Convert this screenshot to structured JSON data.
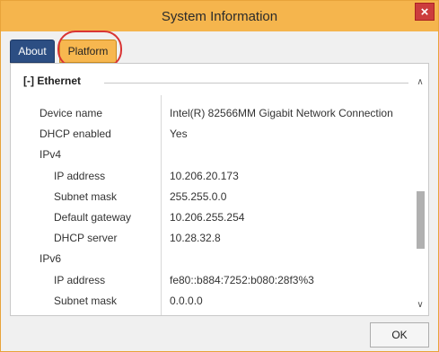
{
  "window": {
    "title": "System Information",
    "close_glyph": "×"
  },
  "tabs": [
    {
      "label": "About",
      "active": false
    },
    {
      "label": "Platform",
      "active": true
    }
  ],
  "group": {
    "header": "[-] Ethernet"
  },
  "rows": [
    {
      "key": "Device name",
      "value": "Intel(R) 82566MM Gigabit Network Connection",
      "indent": 0
    },
    {
      "key": "DHCP enabled",
      "value": "Yes",
      "indent": 0
    },
    {
      "key": "IPv4",
      "value": "",
      "indent": 0
    },
    {
      "key": "IP address",
      "value": "10.206.20.173",
      "indent": 1
    },
    {
      "key": "Subnet mask",
      "value": "255.255.0.0",
      "indent": 1
    },
    {
      "key": "Default gateway",
      "value": "10.206.255.254",
      "indent": 1
    },
    {
      "key": "DHCP server",
      "value": "10.28.32.8",
      "indent": 1
    },
    {
      "key": "IPv6",
      "value": "",
      "indent": 0
    },
    {
      "key": "IP address",
      "value": "fe80::b884:7252:b080:28f3%3",
      "indent": 1
    },
    {
      "key": "Subnet mask",
      "value": "0.0.0.0",
      "indent": 1
    }
  ],
  "buttons": {
    "ok": "OK"
  },
  "icons": {
    "close": "close-icon",
    "scroll_up": "chevron-up-icon",
    "scroll_down": "chevron-down-icon"
  },
  "colors": {
    "titlebar": "#f5b54d",
    "tab_about": "#2c4e83",
    "tab_platform": "#f7b74f",
    "highlight": "#d93434"
  }
}
